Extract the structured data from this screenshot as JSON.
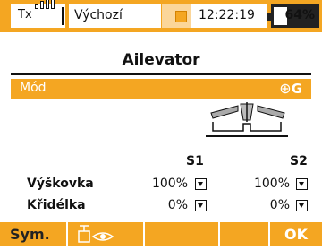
{
  "status_bar": {
    "tx_label": "Tx",
    "signal_icon": "signal-bars-icon",
    "profile": "Výchozí",
    "time": "12:22:19",
    "battery_percent": "64%",
    "battery_level": 0.64
  },
  "title": "Ailevator",
  "mode": {
    "label": "Mód",
    "value": "G",
    "icon": "globe-icon"
  },
  "table": {
    "columns": [
      "S1",
      "S2"
    ],
    "rows": [
      {
        "label": "Výškovka",
        "values": [
          "100%",
          "100%"
        ]
      },
      {
        "label": "Křidélka",
        "values": [
          "0%",
          "0%"
        ]
      }
    ]
  },
  "buttons": {
    "sym": "Sym.",
    "view_icon": "servo-eye-icon",
    "ok": "OK"
  },
  "colors": {
    "accent": "#f4a622",
    "text": "#111111",
    "background": "#ffffff"
  }
}
